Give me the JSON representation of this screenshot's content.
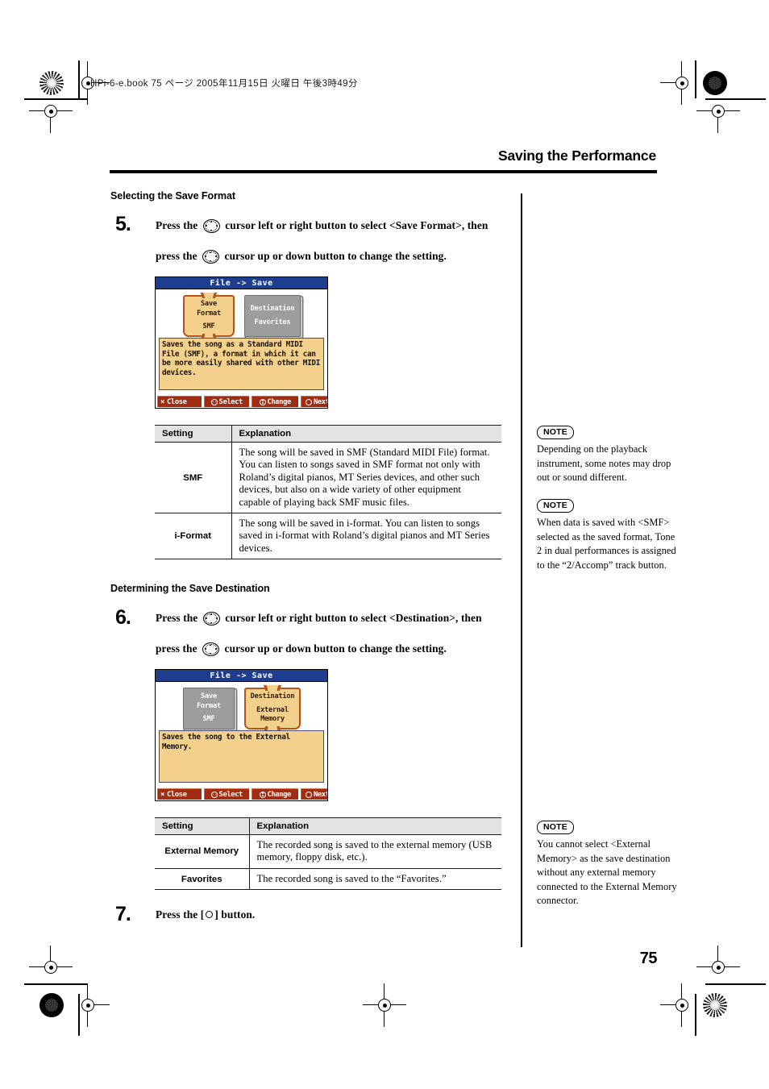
{
  "print_header": {
    "text": "HPi-6-e.book 75 ページ 2005年11月15日  火曜日  午後3時49分"
  },
  "header": {
    "running_title": "Saving the Performance",
    "page_number": "75"
  },
  "sections": [
    {
      "heading": "Selecting the Save Format",
      "step_number": "5.",
      "step_line1_a": "Press the",
      "step_line1_b": "cursor left or right button to select <Save Format>, then",
      "step_line2_a": "press the",
      "step_line2_b": "cursor up or down button to change the setting."
    },
    {
      "heading": "Determining the Save Destination",
      "step_number": "6.",
      "step_line1_a": "Press the",
      "step_line1_b": "cursor left or right button to select <Destination>, then",
      "step_line2_a": "press the",
      "step_line2_b": "cursor up or down button to change the setting."
    }
  ],
  "step7": {
    "number": "7.",
    "text_a": "Press the [",
    "text_b": "] button."
  },
  "lcd1": {
    "title": "File  ->  Save",
    "book_selected": {
      "line1": "Save",
      "line2": "Format",
      "line3": "SMF"
    },
    "book_unselected": {
      "line1": "Destination",
      "line2": "Favorites"
    },
    "description": "Saves the song as a Standard MIDI File (SMF), a format in which it can be more easily shared with other MIDI devices.",
    "keys": [
      {
        "icon": "close-x-icon",
        "label": "Close"
      },
      {
        "icon": "cursor-leftright-icon",
        "label": "Select"
      },
      {
        "icon": "cursor-updown-icon",
        "label": "Change"
      },
      {
        "icon": "round-button-icon",
        "label": "Next"
      }
    ]
  },
  "lcd2": {
    "title": "File  ->  Save",
    "book_unselected": {
      "line1": "Save",
      "line2": "Format",
      "line3": "SMF"
    },
    "book_selected": {
      "line1": "Destination",
      "line2": "External",
      "line3": "Memory"
    },
    "description": "Saves the song to the External Memory.",
    "keys": [
      {
        "icon": "close-x-icon",
        "label": "Close"
      },
      {
        "icon": "cursor-leftright-icon",
        "label": "Select"
      },
      {
        "icon": "cursor-updown-icon",
        "label": "Change"
      },
      {
        "icon": "round-button-icon",
        "label": "Next"
      }
    ]
  },
  "table1": {
    "headers": [
      "Setting",
      "Explanation"
    ],
    "rows": [
      {
        "setting": "SMF",
        "explanation": "The song will be saved in SMF (Standard MIDI File) format. You can listen to songs saved in SMF format not only with Roland’s digital pianos, MT Series devices, and other such devices, but also on a wide variety of other equipment capable of playing back SMF music files."
      },
      {
        "setting": "i-Format",
        "explanation": "The song will be saved in i-format. You can listen to songs saved in i-format with Roland’s digital pianos and MT Series devices."
      }
    ]
  },
  "table2": {
    "headers": [
      "Setting",
      "Explanation"
    ],
    "rows": [
      {
        "setting": "External Memory",
        "explanation": "The recorded song is saved to the external memory (USB memory, floppy disk, etc.)."
      },
      {
        "setting": "Favorites",
        "explanation": "The recorded song is saved to the “Favorites.”"
      }
    ]
  },
  "notes": [
    {
      "badge": "NOTE",
      "body": "Depending on the playback instrument, some notes may drop out or sound different."
    },
    {
      "badge": "NOTE",
      "body": "When data is saved with <SMF> selected as the saved format, Tone 2 in dual performances is assigned to the “2/Accomp” track button."
    },
    {
      "badge": "NOTE",
      "body": "You cannot select <External Memory> as the save destination without any external memory connected to the External Memory connector."
    }
  ],
  "colors": {
    "lcd_titlebar": "#1d3e8f",
    "lcd_panel": "#f3d18d",
    "lcd_key": "#a02d12",
    "book_border": "#b5541a",
    "table_header_bg": "#e3e3e3"
  }
}
